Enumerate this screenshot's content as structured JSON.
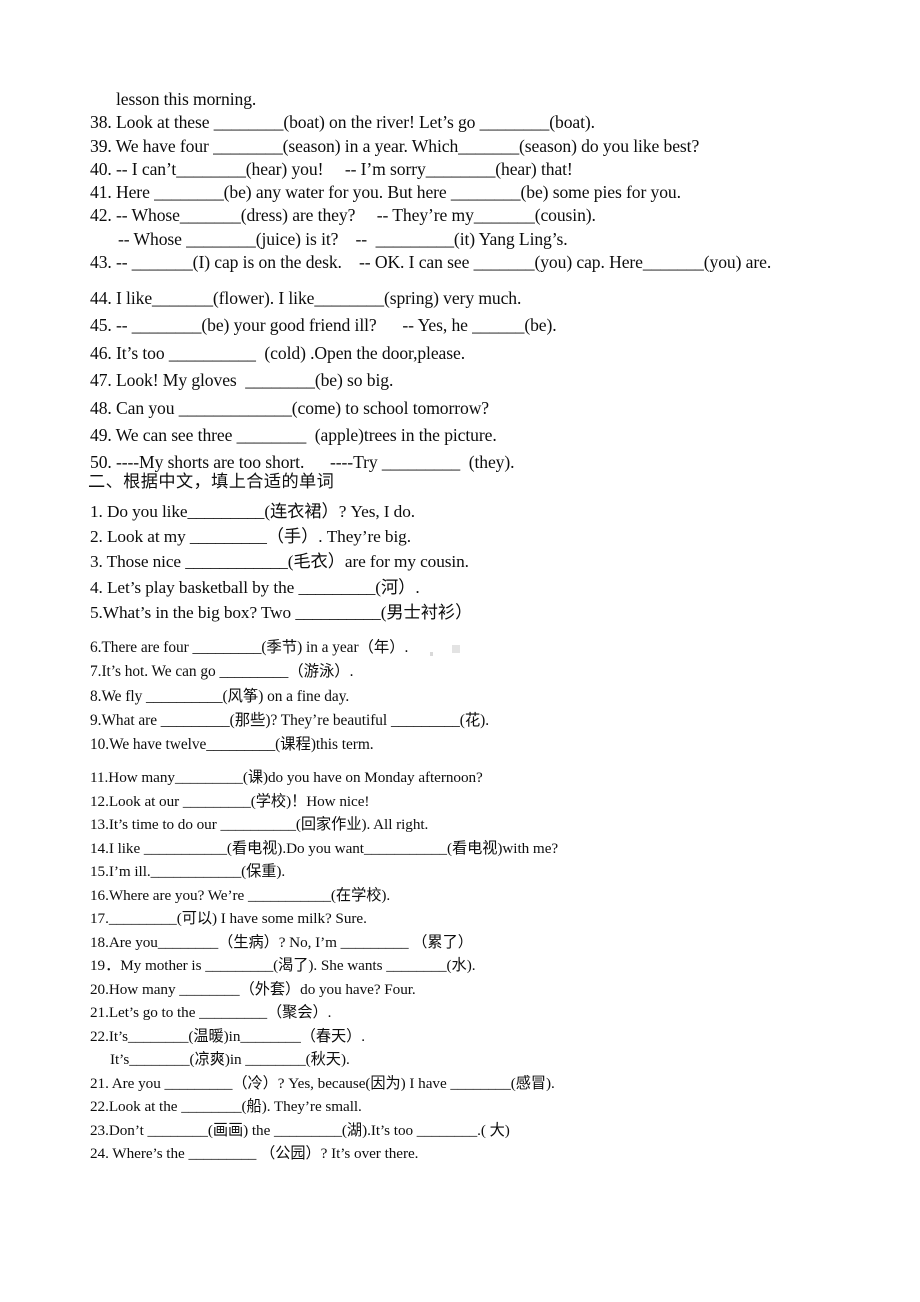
{
  "document": {
    "background_color": "#ffffff",
    "text_color": "#0d0d0d",
    "continued_line": "lesson this morning."
  },
  "section_one_continued": {
    "items": [
      "38. Look at these ________(boat) on the river! Let’s go ________(boat).",
      "39. We have four ________(season) in a year. Which_______(season) do you like best?",
      "40. -- I can’t________(hear) you!     -- I’m sorry________(hear) that!",
      "41. Here ________(be) any water for you. But here ________(be) some pies for you.",
      "42. -- Whose_______(dress) are they?     -- They’re my_______(cousin).",
      "-- Whose ________(juice) is it?    --  _________(it) Yang Ling’s.",
      "43. -- _______(I) cap is on the desk.    -- OK. I can see _______(you) cap. Here_______(you) are."
    ],
    "items_wide": [
      "44. I like_______(flower). I like________(spring) very much.",
      "45. -- ________(be) your good friend ill?      -- Yes, he ______(be).",
      "46. It’s too __________  (cold) .Open the door,please.",
      "47. Look! My gloves  ________(be) so big.",
      "48. Can you _____________(come) to school tomorrow?",
      "49. We can see three ________  (apple)trees in the picture.",
      "50. ----My shorts are too short.      ----Try _________  (they)."
    ]
  },
  "section_two": {
    "heading": "二、根据中文，填上合适的单词",
    "items_large": [
      "1. Do you like_________(连衣裙）? Yes, I do.",
      "2. Look at my _________（手）. They’re big.",
      "3. Those nice ____________(毛衣）are for my cousin.",
      "4. Let’s play basketball by the _________(河）.",
      "5.What’s in the big box? Two __________(男士衬衫）"
    ],
    "items_medium": [
      "6.There are four _________(季节) in a year（年）.",
      "7.It’s hot. We can go _________（游泳）.",
      "8.We fly __________(风筝) on a fine day.",
      "9.What are _________(那些)? They’re beautiful _________(花).",
      "10.We have twelve_________(课程)this term."
    ],
    "items_small": [
      "11.How many_________(课)do you have on Monday afternoon?",
      "12.Look at our _________(学校)！How nice!",
      "13.It’s time to do our __________(回家作业). All right.",
      "14.I like ___________(看电视).Do you want___________(看电视)with me?",
      "15.I’m ill.____________(保重).",
      "16.Where are you? We’re ___________(在学校).",
      "17._________(可以) I have some milk? Sure.",
      "18.Are you________（生病）? No, I’m _________ （累了）",
      "19．My mother is _________(渴了). She wants ________(水).",
      "20.How many ________（外套）do you have? Four.",
      "21.Let’s go to the _________（聚会）.",
      "22.It’s________(温暖)in________（春天）.",
      "It’s________(凉爽)in ________(秋天).",
      "21. Are you _________（冷）? Yes, because(因为) I have ________(感冒).",
      "22.Look at the ________(船). They’re small.",
      "23.Don’t ________(画画) the _________(湖).It’s too ________.( 大)",
      "24. Where’s the _________ （公园）? It’s over there."
    ]
  }
}
